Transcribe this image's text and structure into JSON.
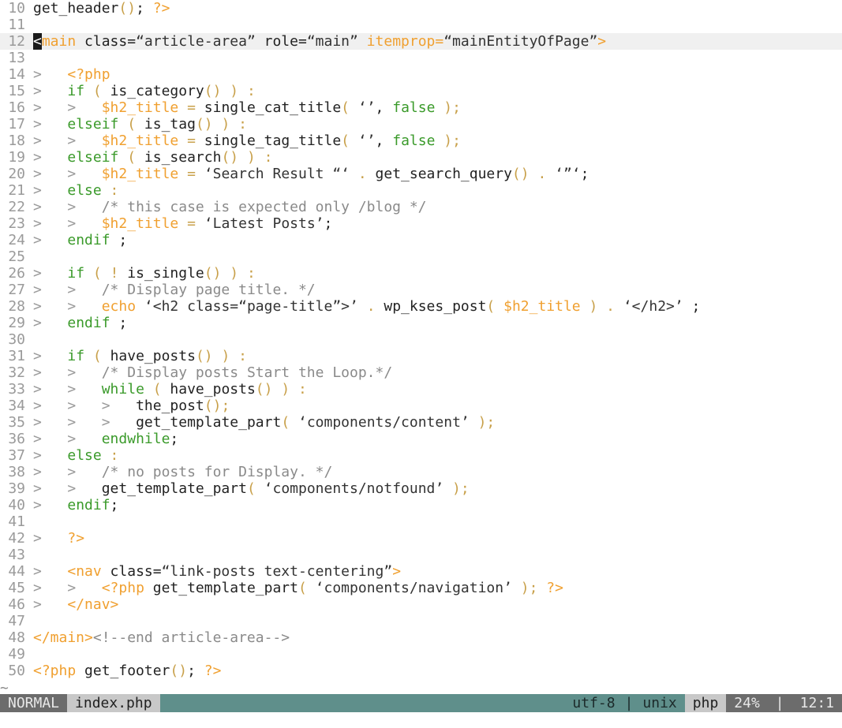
{
  "editor": {
    "lines": [
      {
        "num": "10",
        "segs": [
          [
            "get_header",
            "p"
          ],
          [
            "()",
            "c"
          ],
          [
            "; ",
            "p"
          ],
          [
            "?>",
            "y"
          ]
        ]
      },
      {
        "num": "11",
        "segs": []
      },
      {
        "num": "12",
        "cursor": true,
        "segs": [
          [
            "<",
            "cur"
          ],
          [
            "main",
            "y"
          ],
          [
            " class=",
            "p"
          ],
          [
            "“article-area”",
            "s"
          ],
          [
            " role=",
            "p"
          ],
          [
            "“main”",
            "s"
          ],
          [
            " itemprop=",
            "y"
          ],
          [
            "“mainEntityOfPage”",
            "s"
          ],
          [
            ">",
            "y"
          ]
        ]
      },
      {
        "num": "13",
        "segs": []
      },
      {
        "num": "14",
        "segs": [
          [
            ">   ",
            "d"
          ],
          [
            "<?php",
            "y"
          ]
        ]
      },
      {
        "num": "15",
        "segs": [
          [
            ">   ",
            "d"
          ],
          [
            "if",
            "g"
          ],
          [
            " ( ",
            "c"
          ],
          [
            "is_category",
            "p"
          ],
          [
            "()",
            "c"
          ],
          [
            " ) :",
            "c"
          ]
        ]
      },
      {
        "num": "16",
        "segs": [
          [
            ">   ",
            "d"
          ],
          [
            ">   ",
            "d"
          ],
          [
            "$h2_title",
            "y"
          ],
          [
            " = ",
            "c"
          ],
          [
            "single_cat_title",
            "p"
          ],
          [
            "( ",
            "c"
          ],
          [
            "‘’",
            "s"
          ],
          [
            ", ",
            "p"
          ],
          [
            "false",
            "g"
          ],
          [
            " );",
            "c"
          ]
        ]
      },
      {
        "num": "17",
        "segs": [
          [
            ">   ",
            "d"
          ],
          [
            "elseif",
            "g"
          ],
          [
            " ( ",
            "c"
          ],
          [
            "is_tag",
            "p"
          ],
          [
            "()",
            "c"
          ],
          [
            " ) :",
            "c"
          ]
        ]
      },
      {
        "num": "18",
        "segs": [
          [
            ">   ",
            "d"
          ],
          [
            ">   ",
            "d"
          ],
          [
            "$h2_title",
            "y"
          ],
          [
            " = ",
            "c"
          ],
          [
            "single_tag_title",
            "p"
          ],
          [
            "( ",
            "c"
          ],
          [
            "‘’",
            "s"
          ],
          [
            ", ",
            "p"
          ],
          [
            "false",
            "g"
          ],
          [
            " );",
            "c"
          ]
        ]
      },
      {
        "num": "19",
        "segs": [
          [
            ">   ",
            "d"
          ],
          [
            "elseif",
            "g"
          ],
          [
            " ( ",
            "c"
          ],
          [
            "is_search",
            "p"
          ],
          [
            "()",
            "c"
          ],
          [
            " ) :",
            "c"
          ]
        ]
      },
      {
        "num": "20",
        "segs": [
          [
            ">   ",
            "d"
          ],
          [
            ">   ",
            "d"
          ],
          [
            "$h2_title",
            "y"
          ],
          [
            " = ",
            "c"
          ],
          [
            "‘Search Result “‘",
            "s"
          ],
          [
            " . ",
            "c"
          ],
          [
            "get_search_query",
            "p"
          ],
          [
            "()",
            "c"
          ],
          [
            " . ",
            "c"
          ],
          [
            "‘”‘",
            "s"
          ],
          [
            ";",
            "p"
          ]
        ]
      },
      {
        "num": "21",
        "segs": [
          [
            ">   ",
            "d"
          ],
          [
            "else",
            "g"
          ],
          [
            " :",
            "c"
          ]
        ]
      },
      {
        "num": "22",
        "segs": [
          [
            ">   ",
            "d"
          ],
          [
            ">   ",
            "d"
          ],
          [
            "/* this case is expected only /blog */",
            "cm"
          ]
        ]
      },
      {
        "num": "23",
        "segs": [
          [
            ">   ",
            "d"
          ],
          [
            ">   ",
            "d"
          ],
          [
            "$h2_title",
            "y"
          ],
          [
            " = ",
            "c"
          ],
          [
            "‘Latest Posts’",
            "s"
          ],
          [
            ";",
            "p"
          ]
        ]
      },
      {
        "num": "24",
        "segs": [
          [
            ">   ",
            "d"
          ],
          [
            "endif",
            "g"
          ],
          [
            " ;",
            "p"
          ]
        ]
      },
      {
        "num": "25",
        "segs": []
      },
      {
        "num": "26",
        "segs": [
          [
            ">   ",
            "d"
          ],
          [
            "if",
            "g"
          ],
          [
            " ( ! ",
            "c"
          ],
          [
            "is_single",
            "p"
          ],
          [
            "()",
            "c"
          ],
          [
            " ) :",
            "c"
          ]
        ]
      },
      {
        "num": "27",
        "segs": [
          [
            ">   ",
            "d"
          ],
          [
            ">   ",
            "d"
          ],
          [
            "/* Display page title. */",
            "cm"
          ]
        ]
      },
      {
        "num": "28",
        "segs": [
          [
            ">   ",
            "d"
          ],
          [
            ">   ",
            "d"
          ],
          [
            "echo",
            "y"
          ],
          [
            " ",
            "p"
          ],
          [
            "‘<h2 class=“page-title”>’",
            "s"
          ],
          [
            " . ",
            "c"
          ],
          [
            "wp_kses_post",
            "p"
          ],
          [
            "( ",
            "c"
          ],
          [
            "$h2_title",
            "y"
          ],
          [
            " ) . ",
            "c"
          ],
          [
            "‘</h2>’",
            "s"
          ],
          [
            " ;",
            "p"
          ]
        ]
      },
      {
        "num": "29",
        "segs": [
          [
            ">   ",
            "d"
          ],
          [
            "endif",
            "g"
          ],
          [
            " ;",
            "p"
          ]
        ]
      },
      {
        "num": "30",
        "segs": []
      },
      {
        "num": "31",
        "segs": [
          [
            ">   ",
            "d"
          ],
          [
            "if",
            "g"
          ],
          [
            " ( ",
            "c"
          ],
          [
            "have_posts",
            "p"
          ],
          [
            "()",
            "c"
          ],
          [
            " ) :",
            "c"
          ]
        ]
      },
      {
        "num": "32",
        "segs": [
          [
            ">   ",
            "d"
          ],
          [
            ">   ",
            "d"
          ],
          [
            "/* Display posts Start the Loop.*/",
            "cm"
          ]
        ]
      },
      {
        "num": "33",
        "segs": [
          [
            ">   ",
            "d"
          ],
          [
            ">   ",
            "d"
          ],
          [
            "while",
            "g"
          ],
          [
            " ( ",
            "c"
          ],
          [
            "have_posts",
            "p"
          ],
          [
            "()",
            "c"
          ],
          [
            " ) :",
            "c"
          ]
        ]
      },
      {
        "num": "34",
        "segs": [
          [
            ">   ",
            "d"
          ],
          [
            ">   ",
            "d"
          ],
          [
            ">   ",
            "d"
          ],
          [
            "the_post",
            "p"
          ],
          [
            "();",
            "c"
          ]
        ]
      },
      {
        "num": "35",
        "segs": [
          [
            ">   ",
            "d"
          ],
          [
            ">   ",
            "d"
          ],
          [
            ">   ",
            "d"
          ],
          [
            "get_template_part",
            "p"
          ],
          [
            "( ",
            "c"
          ],
          [
            "‘components/content’",
            "s"
          ],
          [
            " );",
            "c"
          ]
        ]
      },
      {
        "num": "36",
        "segs": [
          [
            ">   ",
            "d"
          ],
          [
            ">   ",
            "d"
          ],
          [
            "endwhile",
            "g"
          ],
          [
            ";",
            "p"
          ]
        ]
      },
      {
        "num": "37",
        "segs": [
          [
            ">   ",
            "d"
          ],
          [
            "else",
            "g"
          ],
          [
            " :",
            "c"
          ]
        ]
      },
      {
        "num": "38",
        "segs": [
          [
            ">   ",
            "d"
          ],
          [
            ">   ",
            "d"
          ],
          [
            "/* no posts for Display. */",
            "cm"
          ]
        ]
      },
      {
        "num": "39",
        "segs": [
          [
            ">   ",
            "d"
          ],
          [
            ">   ",
            "d"
          ],
          [
            "get_template_part",
            "p"
          ],
          [
            "( ",
            "c"
          ],
          [
            "‘components/notfound’",
            "s"
          ],
          [
            " );",
            "c"
          ]
        ]
      },
      {
        "num": "40",
        "segs": [
          [
            ">   ",
            "d"
          ],
          [
            "endif",
            "g"
          ],
          [
            ";",
            "p"
          ]
        ]
      },
      {
        "num": "41",
        "segs": []
      },
      {
        "num": "42",
        "segs": [
          [
            ">   ",
            "d"
          ],
          [
            "?>",
            "y"
          ]
        ]
      },
      {
        "num": "43",
        "segs": []
      },
      {
        "num": "44",
        "segs": [
          [
            ">   ",
            "d"
          ],
          [
            "<nav",
            "y"
          ],
          [
            " class=",
            "p"
          ],
          [
            "“link-posts text-centering”",
            "s"
          ],
          [
            ">",
            "y"
          ]
        ]
      },
      {
        "num": "45",
        "segs": [
          [
            ">   ",
            "d"
          ],
          [
            ">   ",
            "d"
          ],
          [
            "<?php",
            "y"
          ],
          [
            " get_template_part",
            "p"
          ],
          [
            "( ",
            "c"
          ],
          [
            "‘components/navigation’",
            "s"
          ],
          [
            " ); ",
            "c"
          ],
          [
            "?>",
            "y"
          ]
        ]
      },
      {
        "num": "46",
        "segs": [
          [
            ">   ",
            "d"
          ],
          [
            "</nav>",
            "y"
          ]
        ]
      },
      {
        "num": "47",
        "segs": []
      },
      {
        "num": "48",
        "segs": [
          [
            "</main>",
            "y"
          ],
          [
            "<!--end article-area-->",
            "cm"
          ]
        ]
      },
      {
        "num": "49",
        "segs": []
      },
      {
        "num": "50",
        "segs": [
          [
            "<?php",
            "y"
          ],
          [
            " get_footer",
            "p"
          ],
          [
            "()",
            "c"
          ],
          [
            "; ",
            "p"
          ],
          [
            "?>",
            "y"
          ]
        ]
      }
    ]
  },
  "tilde": "~",
  "statusline": {
    "mode": "NORMAL",
    "filename": "index.php",
    "encoding": "utf-8",
    "sep1": "|",
    "fileformat": "unix",
    "filetype": "php",
    "percent": "24%",
    "sep2": "|",
    "position": "12:1"
  }
}
